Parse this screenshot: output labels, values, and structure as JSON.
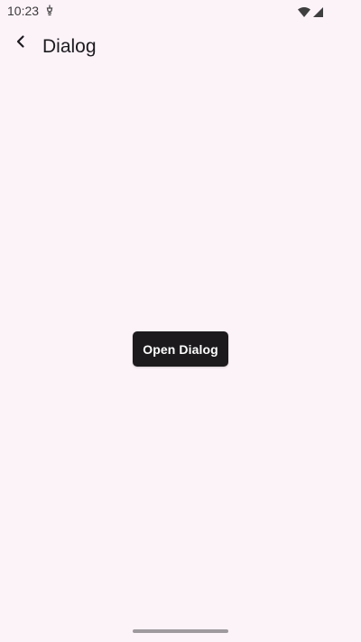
{
  "status_bar": {
    "time": "10:23",
    "icons": [
      "notification-icon",
      "wifi-icon",
      "cell-signal-icon"
    ]
  },
  "app_bar": {
    "back_icon": "arrow-back-icon",
    "title": "Dialog"
  },
  "main": {
    "open_dialog_label": "Open Dialog"
  },
  "colors": {
    "background": "#fcf3f9",
    "button": "#1c1a1d",
    "button_text": "#ffffff",
    "nav_handle": "#9e9a9e"
  }
}
